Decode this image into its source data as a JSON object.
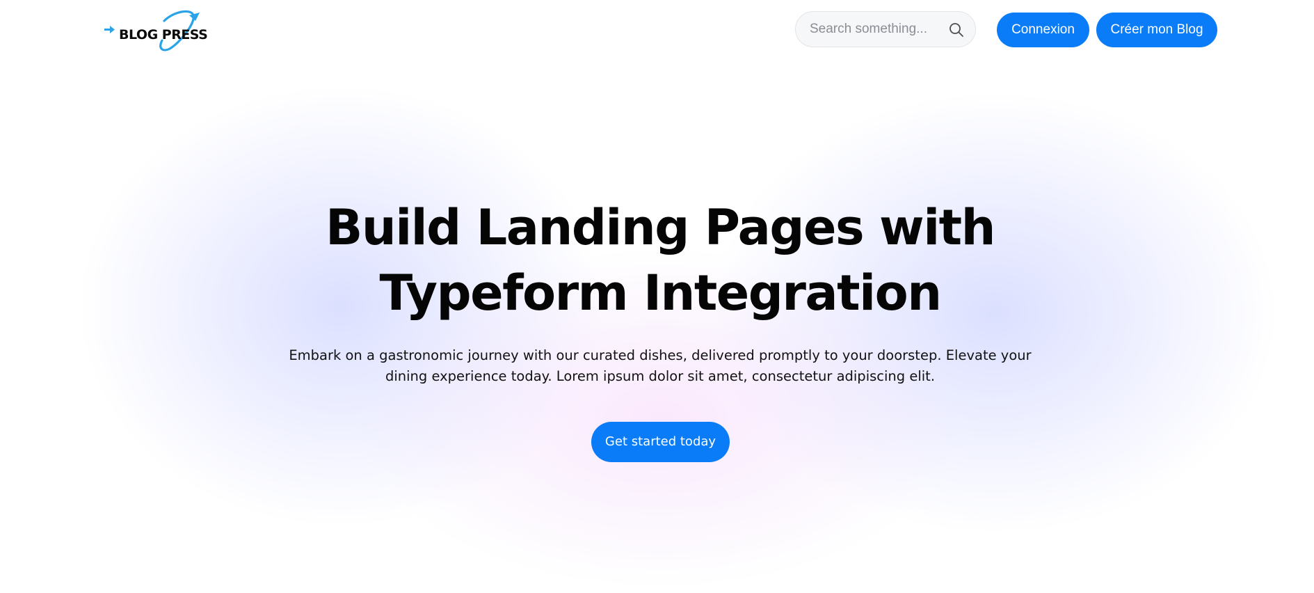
{
  "brand": {
    "logo_text": "BLOG PRESS",
    "logo_icon": "arrow-orbit-icon",
    "accent_color": "#0a7cf8",
    "logo_accent_color": "#2aa3e8"
  },
  "header": {
    "search": {
      "placeholder": "Search something...",
      "value": "",
      "icon": "search-icon"
    },
    "login_label": "Connexion",
    "create_blog_label": "Créer mon Blog"
  },
  "hero": {
    "title_line1": "Build Landing Pages with",
    "title_line2": "Typeform Integration",
    "description_line1": "Embark on a gastronomic journey with our curated dishes, delivered promptly to your doorstep. Elevate your",
    "description_line2": "dining experience today. Lorem ipsum dolor sit amet, consectetur adipiscing elit.",
    "cta_label": "Get started today"
  }
}
